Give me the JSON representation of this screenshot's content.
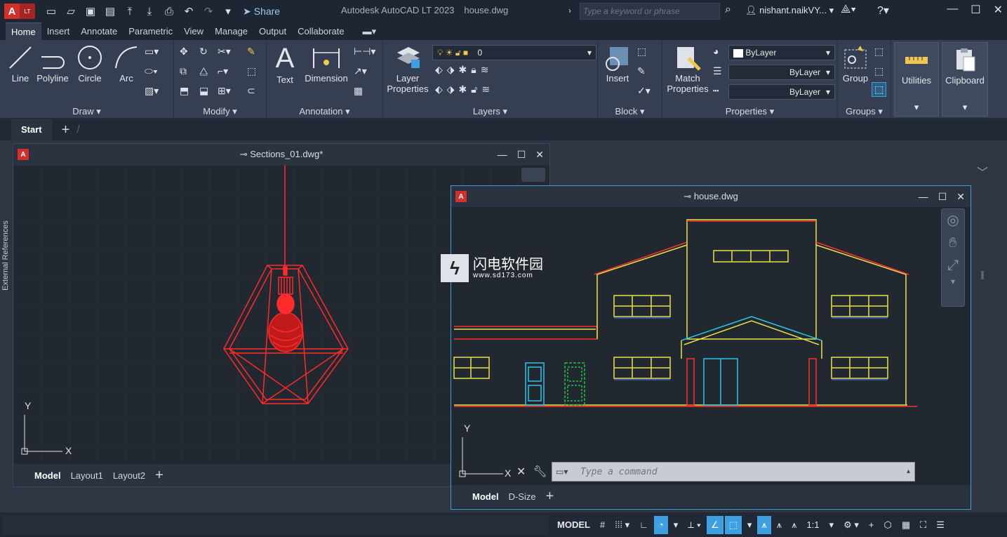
{
  "app": {
    "badge": "A",
    "badge_sub": "LT",
    "title": "Autodesk AutoCAD LT 2023",
    "document": "house.dwg",
    "share_label": "Share",
    "search_placeholder": "Type a keyword or phrase",
    "user": "nishant.naikVY..."
  },
  "ribbon_tabs": [
    "Home",
    "Insert",
    "Annotate",
    "Parametric",
    "View",
    "Manage",
    "Output",
    "Collaborate"
  ],
  "ribbon": {
    "draw": {
      "title": "Draw",
      "tools": [
        "Line",
        "Polyline",
        "Circle",
        "Arc"
      ]
    },
    "modify": {
      "title": "Modify"
    },
    "annotation": {
      "title": "Annotation",
      "text": "Text",
      "dimension": "Dimension"
    },
    "layers": {
      "title": "Layers",
      "layer_properties_1": "Layer",
      "layer_properties_2": "Properties",
      "current_layer": "0"
    },
    "block": {
      "title": "Block",
      "insert": "Insert"
    },
    "properties": {
      "title": "Properties",
      "match_1": "Match",
      "match_2": "Properties",
      "color": "ByLayer",
      "linetype": "ByLayer",
      "lineweight": "ByLayer"
    },
    "groups": {
      "title": "Groups",
      "group": "Group"
    },
    "utilities": "Utilities",
    "clipboard": "Clipboard"
  },
  "file_tabs": {
    "start": "Start"
  },
  "side_palette": "External References",
  "window1": {
    "title": "Sections_01.dwg*",
    "layouts": [
      "Model",
      "Layout1",
      "Layout2"
    ]
  },
  "window2": {
    "title": "house.dwg",
    "layouts": [
      "Model",
      "D-Size"
    ],
    "command_placeholder": "Type a command"
  },
  "watermark": {
    "name": "闪电软件园",
    "url": "www.sd173.com"
  },
  "status": {
    "model": "MODEL",
    "scale": "1:1"
  },
  "colors": {
    "accent": "#3ea0e0",
    "lamp": "#ff2a2a",
    "house_yellow": "#e8e04a",
    "house_cyan": "#2ec6e6",
    "house_red": "#ff3030"
  }
}
